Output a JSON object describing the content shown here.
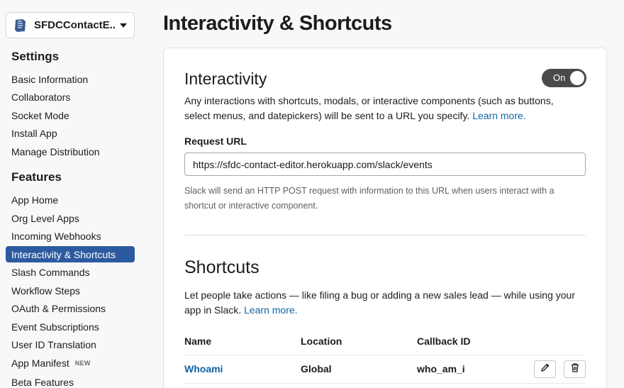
{
  "app": {
    "name": "SFDCContactE..."
  },
  "sidebar": {
    "settings_heading": "Settings",
    "settings_items": [
      {
        "label": "Basic Information"
      },
      {
        "label": "Collaborators"
      },
      {
        "label": "Socket Mode"
      },
      {
        "label": "Install App"
      },
      {
        "label": "Manage Distribution"
      }
    ],
    "features_heading": "Features",
    "features_items": [
      {
        "label": "App Home"
      },
      {
        "label": "Org Level Apps"
      },
      {
        "label": "Incoming Webhooks"
      },
      {
        "label": "Interactivity & Shortcuts",
        "active": true
      },
      {
        "label": "Slash Commands"
      },
      {
        "label": "Workflow Steps"
      },
      {
        "label": "OAuth & Permissions"
      },
      {
        "label": "Event Subscriptions"
      },
      {
        "label": "User ID Translation"
      },
      {
        "label": "App Manifest",
        "badge": "NEW"
      },
      {
        "label": "Beta Features"
      }
    ]
  },
  "page": {
    "title": "Interactivity & Shortcuts"
  },
  "interactivity": {
    "title": "Interactivity",
    "toggle_label": "On",
    "description": "Any interactions with shortcuts, modals, or interactive components (such as buttons, select menus, and datepickers) will be sent to a URL you specify.",
    "learn_more": "Learn more.",
    "request_url_label": "Request URL",
    "request_url_value": "https://sfdc-contact-editor.herokuapp.com/slack/events",
    "help_text": "Slack will send an HTTP POST request with information to this URL when users interact with a shortcut or interactive component."
  },
  "shortcuts": {
    "title": "Shortcuts",
    "description": "Let people take actions — like filing a bug or adding a new sales lead — while using your app in Slack.",
    "learn_more": "Learn more.",
    "columns": {
      "name": "Name",
      "location": "Location",
      "callback_id": "Callback ID"
    },
    "rows": [
      {
        "name": "Whoami",
        "location": "Global",
        "callback_id": "who_am_i"
      }
    ]
  },
  "colors": {
    "accent": "#2c5aa0",
    "link": "#1264a3",
    "toggle_on": "#4a4a4a"
  }
}
